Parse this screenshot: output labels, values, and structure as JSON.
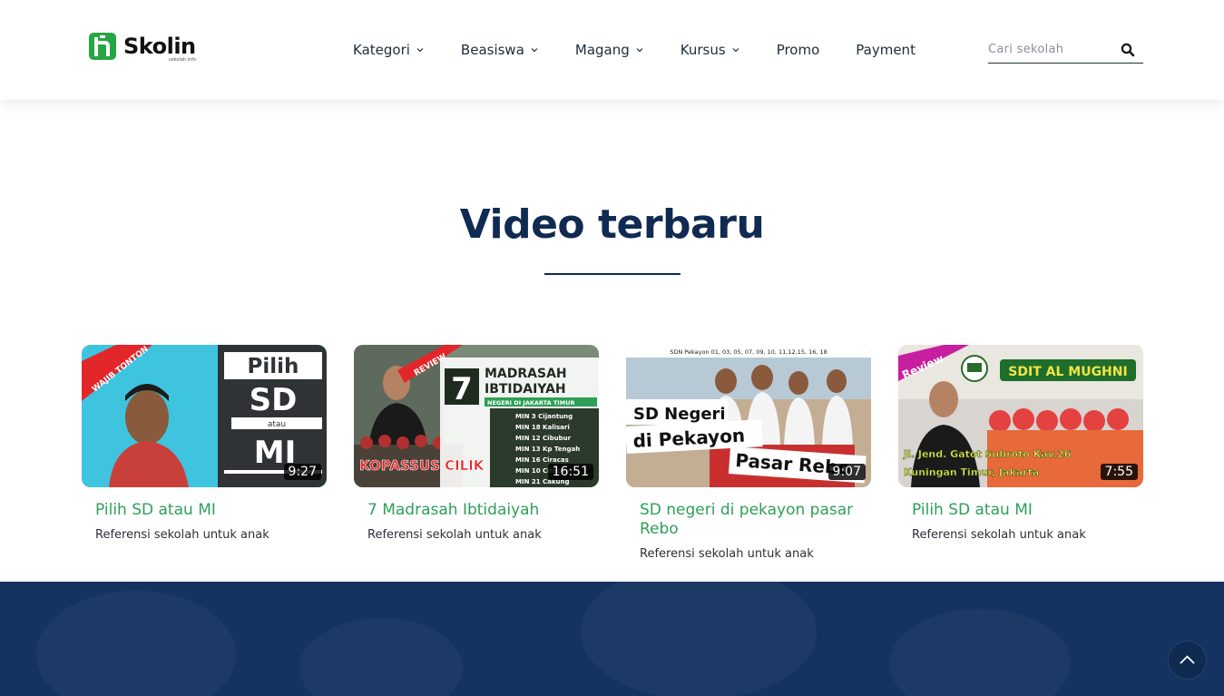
{
  "brand": {
    "name": "Skolin",
    "tagline": "sekolah.info"
  },
  "nav": {
    "items": [
      {
        "label": "Kategori",
        "dropdown": true
      },
      {
        "label": "Beasiswa",
        "dropdown": true
      },
      {
        "label": "Magang",
        "dropdown": true
      },
      {
        "label": "Kursus",
        "dropdown": true
      },
      {
        "label": "Promo",
        "dropdown": false
      },
      {
        "label": "Payment",
        "dropdown": false
      }
    ]
  },
  "search": {
    "placeholder": "Cari sekolah"
  },
  "section": {
    "title": "Video terbaru"
  },
  "videos": [
    {
      "title": "Pilih SD atau MI",
      "description": "Referensi sekolah untuk anak",
      "duration": "9:27",
      "thumb": {
        "ribbon": "WAJIB TONTON",
        "line1": "Pilih",
        "line2": "SD",
        "line3": "atau",
        "line4": "MI"
      }
    },
    {
      "title": "7 Madrasah Ibtidaiyah",
      "description": "Referensi sekolah untuk anak",
      "duration": "16:51",
      "thumb": {
        "ribbon": "REVIEW",
        "number": "7",
        "heading1": "MADRASAH",
        "heading2": "IBTIDAIYAH",
        "sub": "NEGERI DI JAKARTA TIMUR",
        "list": [
          "MIN 3 Cijantung",
          "MIN 18 Kalisari",
          "MIN 12 Cibubur",
          "MIN 13 Kp Tengah",
          "MIN 16 Ciracas",
          "MIN 10 Ciracas",
          "MIN 21 Cakung"
        ],
        "caption": "KOPASSUS CILIK"
      }
    },
    {
      "title": "SD negeri di pekayon pasar Rebo",
      "description": "Referensi sekolah untuk anak",
      "duration": "9:07",
      "thumb": {
        "top": "SDN Pekayon 01, 03, 05, 07, 09, 10, 11,12,15, 16, 18",
        "line1": "SD Negeri",
        "line2": "di Pekayon",
        "line3": "Pasar Rebo"
      }
    },
    {
      "title": "Pilih SD atau MI",
      "description": "Referensi sekolah untuk anak",
      "duration": "7:55",
      "thumb": {
        "ribbon": "Review",
        "school": "SDIT AL MUGHNI",
        "addr1": "Jl. Jend. Gatot Subroto Kav.26",
        "addr2": "Kuningan Timur, Jakarta"
      }
    }
  ],
  "colors": {
    "brand_green": "#27a644",
    "title_navy": "#102a52",
    "link_green": "#2e9f57",
    "footer_navy": "#153361"
  },
  "icons": {
    "search": "search-icon",
    "dropdown": "chevron-down-icon",
    "scroll_top": "chevron-up-icon"
  }
}
